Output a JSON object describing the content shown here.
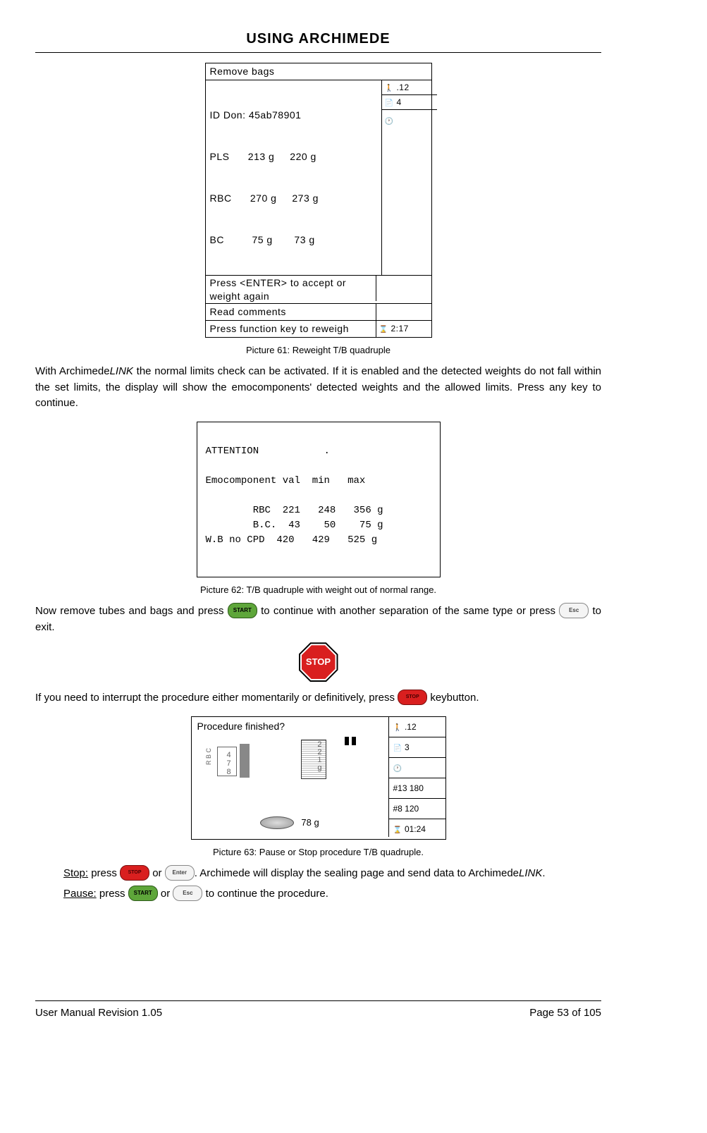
{
  "header": {
    "title": "USING ARCHIMEDE"
  },
  "figure61": {
    "caption": "Picture 61: Reweight T/B quadruple",
    "title": "Remove bags",
    "id_line": "ID Don: 45ab78901",
    "rows": [
      "PLS      213 g     220 g",
      "RBC      270 g     273 g",
      "BC         75 g       73 g"
    ],
    "prompt": "Press <ENTER> to accept or weight again",
    "note": "Read comments",
    "status": "Press function key to reweigh",
    "side_person": ".12",
    "side_page": "4",
    "side_timer": "2:17"
  },
  "para1": {
    "pre": "With Archimede",
    "link": "LINK",
    "post": " the normal limits check can be activated. If it is enabled and the detected weights do not fall within the set limits, the display will show the emocomponents' detected weights and the allowed limits. Press any key to continue."
  },
  "figure62": {
    "caption": "Picture 62: T/B quadruple with weight out of normal range.",
    "title": "ATTENTION           .",
    "header_row": "Emocomponent val  min   max",
    "rows": [
      "        RBC  221   248   356 g",
      "        B.C.  43    50    75 g",
      "W.B no CPD  420   429   525 g"
    ]
  },
  "para2": {
    "t1": "Now remove tubes and bags and press ",
    "t2": " to continue with another separation of the same type or press ",
    "t3": " to exit."
  },
  "keys": {
    "start": "START",
    "esc": "Esc",
    "stop": "STOP",
    "enter": "Enter"
  },
  "stop_sign": "STOP",
  "para3": {
    "t1": "If you need to interrupt the procedure either momentarily or definitively, press ",
    "t2": " keybutton."
  },
  "figure63": {
    "caption": "Picture 63: Pause or Stop procedure T/B quadruple.",
    "title": "Procedure finished?",
    "vals_left": "4\n7\n8",
    "vals_mid": "2\n2\n1\ng",
    "rbc": "R B C",
    "bottom_g": "78 g",
    "side": [
      ".12",
      "3",
      "",
      "#13 180",
      "#8 120",
      "01:24"
    ]
  },
  "para4": {
    "stop_label": "Stop:",
    "stop_t1": " press ",
    "stop_t2": " or ",
    "stop_t3": ". Archimede will display the sealing page and send data to Archimede",
    "link": "LINK",
    "stop_t4": ".",
    "pause_label": "Pause:",
    "pause_t1": " press ",
    "pause_t2": " or ",
    "pause_t3": " to continue the procedure."
  },
  "footer": {
    "left": "User Manual Revision 1.05",
    "right": "Page 53 of 105"
  }
}
